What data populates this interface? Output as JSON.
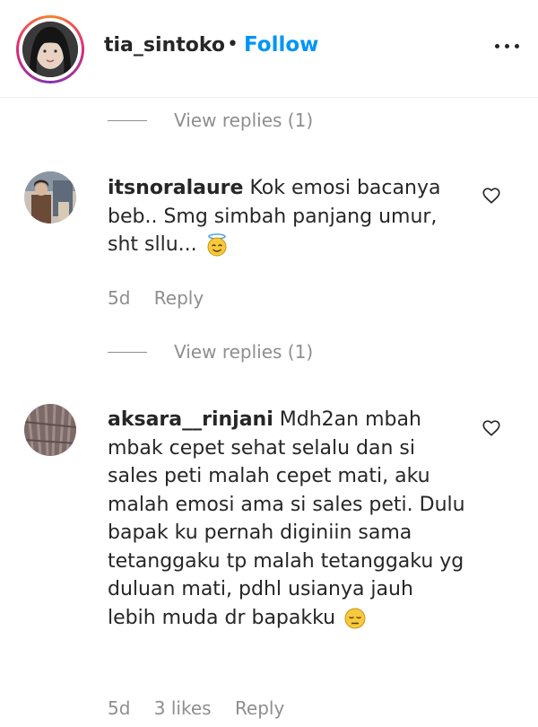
{
  "header": {
    "username": "tia_sintoko",
    "separator": "•",
    "follow_label": "Follow",
    "more_icon": "more-horizontal-icon"
  },
  "replies_toggle_1": {
    "label": "View replies (1)"
  },
  "comment_1": {
    "username": "itsnoralaure",
    "text": "Kok emosi bacanya beb.. Smg simbah panjang umur, sht sllu...",
    "emoji": "smiling-face-with-halo",
    "time": "5d",
    "reply_label": "Reply"
  },
  "replies_toggle_2": {
    "label": "View replies (1)"
  },
  "comment_2": {
    "username": "aksara__rinjani",
    "text": "Mdh2an mbah mbak cepet sehat selalu dan si sales peti malah cepet mati, aku malah emosi ama si sales peti. Dulu bapak ku pernah diginiin sama tetanggaku tp malah tetanggaku yg duluan mati, pdhl usianya jauh lebih muda dr bapakku",
    "emoji": "pensive-face",
    "time": "5d",
    "likes": "3 likes",
    "reply_label": "Reply"
  },
  "colors": {
    "text": "#262626",
    "secondary": "#8e8e8e",
    "link": "#0095f6",
    "divider": "#ededed"
  }
}
